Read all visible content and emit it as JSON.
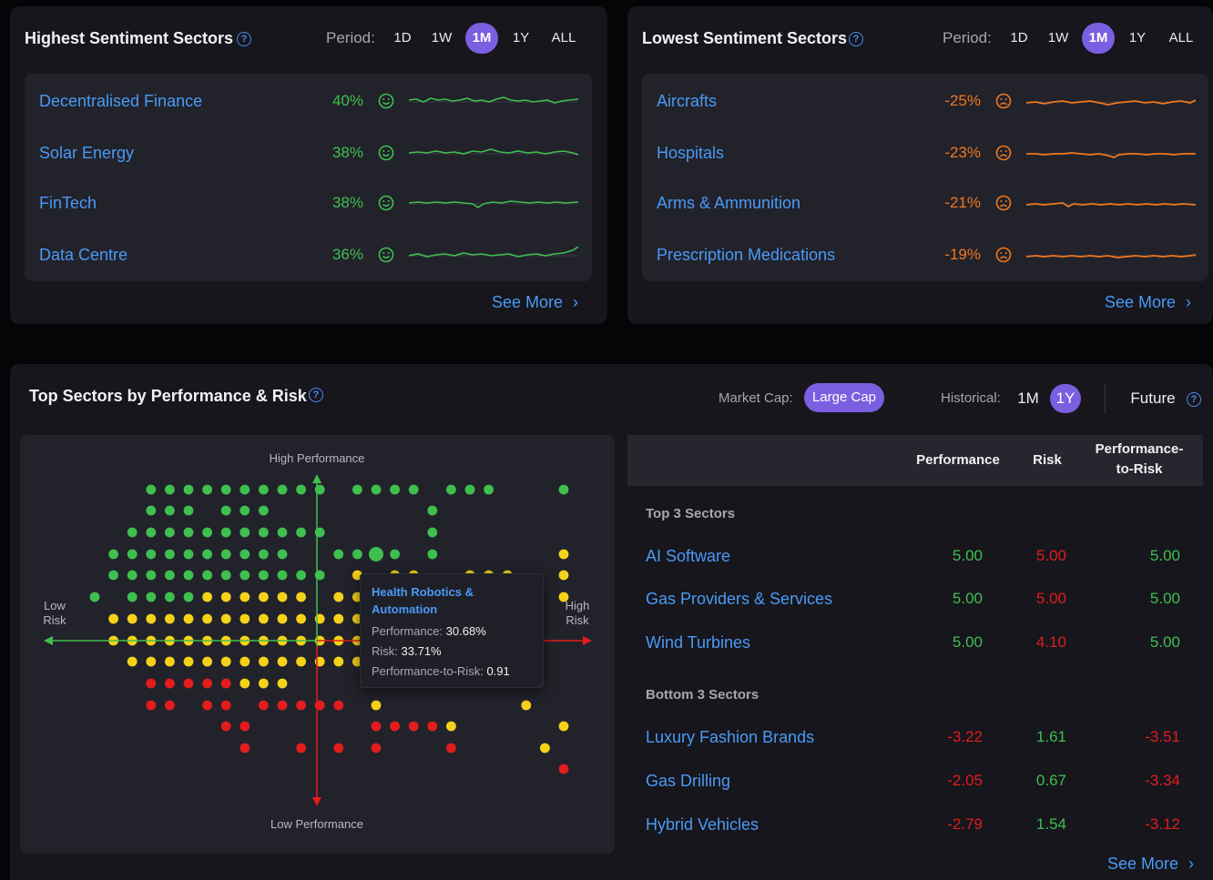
{
  "highest": {
    "title": "Highest Sentiment Sectors",
    "period_label": "Period:",
    "periods": [
      "1D",
      "1W",
      "1M",
      "1Y",
      "ALL"
    ],
    "active_period": "1M",
    "rows": [
      {
        "name": "Decentralised Finance",
        "pct": "40%"
      },
      {
        "name": "Solar Energy",
        "pct": "38%"
      },
      {
        "name": "FinTech",
        "pct": "38%"
      },
      {
        "name": "Data Centre",
        "pct": "36%"
      }
    ],
    "see_more": "See More"
  },
  "lowest": {
    "title": "Lowest Sentiment Sectors",
    "period_label": "Period:",
    "periods": [
      "1D",
      "1W",
      "1M",
      "1Y",
      "ALL"
    ],
    "active_period": "1M",
    "rows": [
      {
        "name": "Aircrafts",
        "pct": "-25%"
      },
      {
        "name": "Hospitals",
        "pct": "-23%"
      },
      {
        "name": "Arms & Ammunition",
        "pct": "-21%"
      },
      {
        "name": "Prescription Medications",
        "pct": "-19%"
      }
    ],
    "see_more": "See More"
  },
  "performance": {
    "title": "Top Sectors by Performance & Risk",
    "market_cap_label": "Market Cap:",
    "market_cap_value": "Large Cap",
    "historical_label": "Historical:",
    "historical_options": [
      "1M",
      "1Y"
    ],
    "historical_active": "1Y",
    "future_label": "Future",
    "axes": {
      "top": "High Performance",
      "bottom": "Low Performance",
      "left_1": "Low",
      "left_2": "Risk",
      "right_1": "High",
      "right_2": "Risk"
    },
    "tooltip": {
      "title_1": "Health Robotics &",
      "title_2": "Automation",
      "perf_label": "Performance:",
      "perf_value": "30.68%",
      "risk_label": "Risk:",
      "risk_value": "33.71%",
      "ptr_label": "Performance-to-Risk:",
      "ptr_value": "0.91"
    },
    "table": {
      "headers": {
        "performance": "Performance",
        "risk": "Risk",
        "ptr_1": "Performance-",
        "ptr_2": "to-Risk"
      },
      "top_label": "Top 3 Sectors",
      "bottom_label": "Bottom 3 Sectors",
      "top_rows": [
        {
          "name": "AI Software",
          "performance": "5.00",
          "risk": "5.00",
          "ptr": "5.00"
        },
        {
          "name": "Gas Providers & Services",
          "performance": "5.00",
          "risk": "5.00",
          "ptr": "5.00"
        },
        {
          "name": "Wind Turbines",
          "performance": "5.00",
          "risk": "4.10",
          "ptr": "5.00"
        }
      ],
      "bottom_rows": [
        {
          "name": "Luxury Fashion Brands",
          "performance": "-3.22",
          "risk": "1.61",
          "ptr": "-3.51"
        },
        {
          "name": "Gas Drilling",
          "performance": "-2.05",
          "risk": "0.67",
          "ptr": "-3.34"
        },
        {
          "name": "Hybrid Vehicles",
          "performance": "-2.79",
          "risk": "1.54",
          "ptr": "-3.12"
        }
      ]
    },
    "see_more": "See More"
  },
  "colors": {
    "accent": "#7a5fe0",
    "link": "#4a9af5",
    "positive": "#3fbf4f",
    "negative_sentiment": "#f0781e",
    "negative_value": "#e11d1d",
    "dot_yellow": "#f5d21a"
  }
}
